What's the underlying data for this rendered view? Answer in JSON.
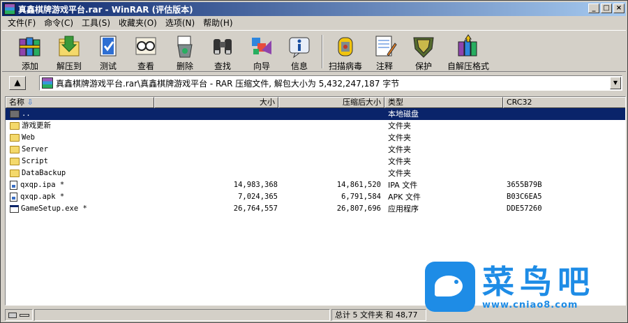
{
  "window": {
    "title": "真鑫棋牌游戏平台.rar - WinRAR (评估版本)",
    "controls": {
      "minimize": "_",
      "maximize": "□",
      "close": "×"
    }
  },
  "menu": [
    "文件(F)",
    "命令(C)",
    "工具(S)",
    "收藏夹(O)",
    "选项(N)",
    "帮助(H)"
  ],
  "toolbar": [
    {
      "label": "添加",
      "icon": "add-books-icon"
    },
    {
      "label": "解压到",
      "icon": "extract-folder-icon"
    },
    {
      "label": "测试",
      "icon": "test-clipboard-icon"
    },
    {
      "label": "查看",
      "icon": "view-glasses-icon"
    },
    {
      "label": "删除",
      "icon": "delete-bin-icon"
    },
    {
      "label": "查找",
      "icon": "find-binoculars-icon"
    },
    {
      "label": "向导",
      "icon": "wizard-icon"
    },
    {
      "label": "信息",
      "icon": "info-icon"
    },
    {
      "label": "扫描病毒",
      "icon": "virus-scan-icon"
    },
    {
      "label": "注释",
      "icon": "comment-icon"
    },
    {
      "label": "保护",
      "icon": "protect-shield-icon"
    },
    {
      "label": "自解压格式",
      "icon": "sfx-icon"
    }
  ],
  "address": {
    "up_label": "▲",
    "path": "真鑫棋牌游戏平台.rar\\真鑫棋牌游戏平台 - RAR 压缩文件, 解包大小为 5,432,247,187 字节"
  },
  "columns": {
    "name": "名称",
    "size": "大小",
    "packed": "压缩后大小",
    "type": "类型",
    "crc": "CRC32"
  },
  "rows": [
    {
      "name": "..",
      "size": "",
      "packed": "",
      "type": "本地磁盘",
      "crc": "",
      "kind": "parent",
      "selected": true
    },
    {
      "name": "游戏更新",
      "size": "",
      "packed": "",
      "type": "文件夹",
      "crc": "",
      "kind": "folder"
    },
    {
      "name": "Web",
      "size": "",
      "packed": "",
      "type": "文件夹",
      "crc": "",
      "kind": "folder"
    },
    {
      "name": "Server",
      "size": "",
      "packed": "",
      "type": "文件夹",
      "crc": "",
      "kind": "folder"
    },
    {
      "name": "Script",
      "size": "",
      "packed": "",
      "type": "文件夹",
      "crc": "",
      "kind": "folder"
    },
    {
      "name": "DataBackup",
      "size": "",
      "packed": "",
      "type": "文件夹",
      "crc": "",
      "kind": "folder"
    },
    {
      "name": "qxqp.ipa *",
      "size": "14,983,368",
      "packed": "14,861,520",
      "type": "IPA 文件",
      "crc": "3655B79B",
      "kind": "file"
    },
    {
      "name": "qxqp.apk *",
      "size": "7,024,365",
      "packed": "6,791,584",
      "type": "APK 文件",
      "crc": "B03C6EA5",
      "kind": "file"
    },
    {
      "name": "GameSetup.exe *",
      "size": "26,764,557",
      "packed": "26,807,696",
      "type": "应用程序",
      "crc": "DDE57260",
      "kind": "exe"
    }
  ],
  "status": {
    "summary": "总计 5 文件夹 和 48,77"
  },
  "watermark": {
    "name": "菜鸟吧",
    "url": "www.cniao8.com"
  }
}
